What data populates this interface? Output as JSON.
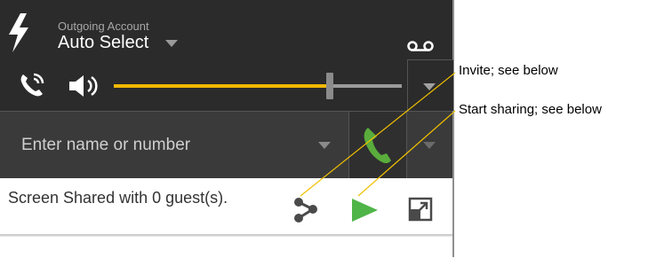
{
  "account": {
    "label": "Outgoing Account",
    "value": "Auto Select"
  },
  "audio": {
    "volume_level": 0.75
  },
  "dial": {
    "placeholder": "Enter name or number"
  },
  "share": {
    "status_text": "Screen Shared with 0 guest(s)."
  },
  "callouts": {
    "invite": "Invite; see below",
    "start_sharing": "Start sharing; see below"
  },
  "colors": {
    "panel_bg": "#2b2b2b",
    "slider_accent": "#f0b800",
    "call_green": "#5aac3c",
    "leader_line": "#f0c000"
  },
  "icons": {
    "bolt": "lightning-bolt-icon",
    "voicemail": "voicemail-icon",
    "phone": "phone-icon",
    "speaker": "speaker-icon",
    "call": "phone-handset-icon",
    "invite": "share-nodes-icon",
    "start": "play-icon",
    "popout": "popout-icon"
  }
}
